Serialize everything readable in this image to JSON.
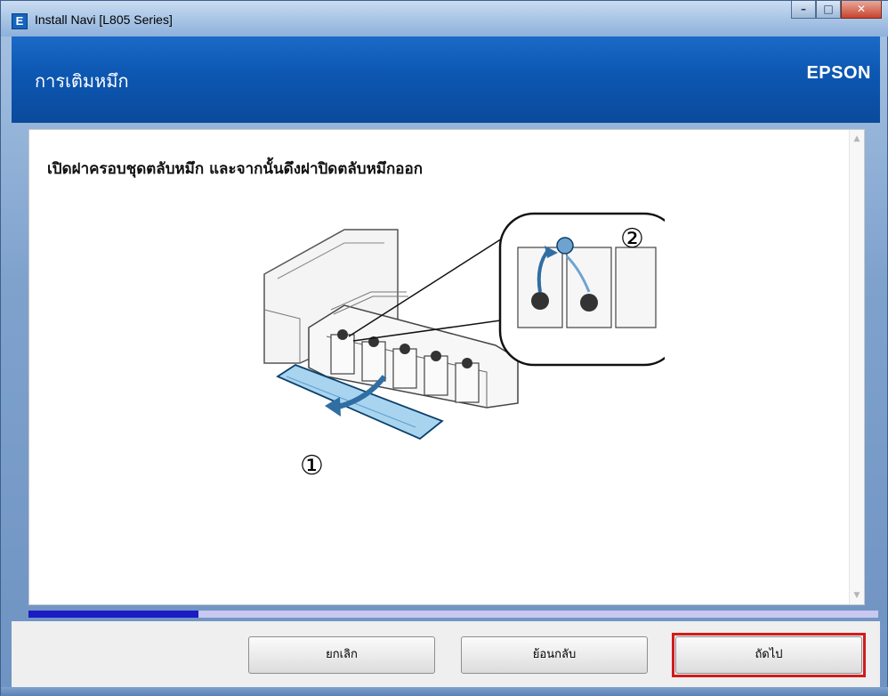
{
  "window": {
    "title": "Install Navi [L805 Series]",
    "icon": "app-icon-e",
    "controls": {
      "minimize": "minimize-icon",
      "maximize": "maximize-icon",
      "close": "close-icon"
    }
  },
  "header": {
    "title": "การเติมหมึก",
    "brand": "EPSON"
  },
  "content": {
    "instruction": "เปิดฝาครอบชุดตลับหมึก และจากนั้นดึงฝาปิดตลับหมึกออก",
    "illustration": {
      "step1_marker": "①",
      "step2_marker": "②"
    }
  },
  "progress": {
    "value_fraction": 0.2
  },
  "footer": {
    "cancel_label": "ยกเลิก",
    "back_label": "ย้อนกลับ",
    "next_label": "ถัดไป"
  },
  "colors": {
    "header_blue": "#0d58b3",
    "progress_fill": "#1c1cc4",
    "progress_track": "#c8c8f0",
    "highlight_red": "#d11c1c",
    "ink_cover": "#a8d4f0"
  }
}
